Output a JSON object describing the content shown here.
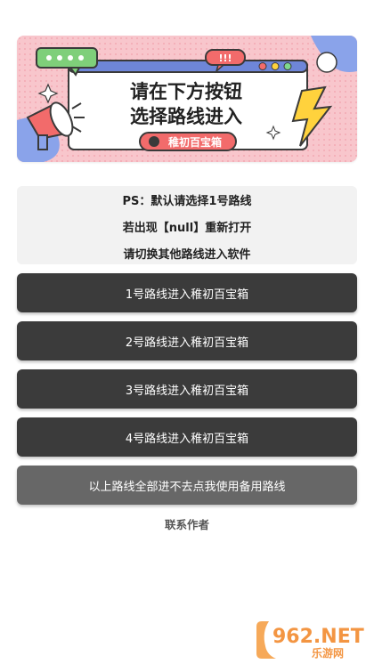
{
  "banner": {
    "title_line1": "请在下方按钮",
    "title_line2": "选择路线进入",
    "badge": "稚初百宝箱",
    "bubble_text": "!!!"
  },
  "notice": {
    "lines": [
      "PS：默认请选择1号路线",
      "若出现【null】重新打开",
      "请切换其他路线进入软件"
    ]
  },
  "routes": [
    {
      "label": "1号路线进入稚初百宝箱"
    },
    {
      "label": "2号路线进入稚初百宝箱"
    },
    {
      "label": "3号路线进入稚初百宝箱"
    },
    {
      "label": "4号路线进入稚初百宝箱"
    }
  ],
  "backup": {
    "label": "以上路线全部进不去点我使用备用路线"
  },
  "contact": {
    "label": "联系作者"
  },
  "watermark": {
    "brand": "962.NET",
    "sub": "乐游网"
  },
  "colors": {
    "button_dark": "#3b3b3b",
    "button_backup": "#676767",
    "banner_pink": "#f7c3c9",
    "bolt_yellow": "#ffd23d"
  }
}
